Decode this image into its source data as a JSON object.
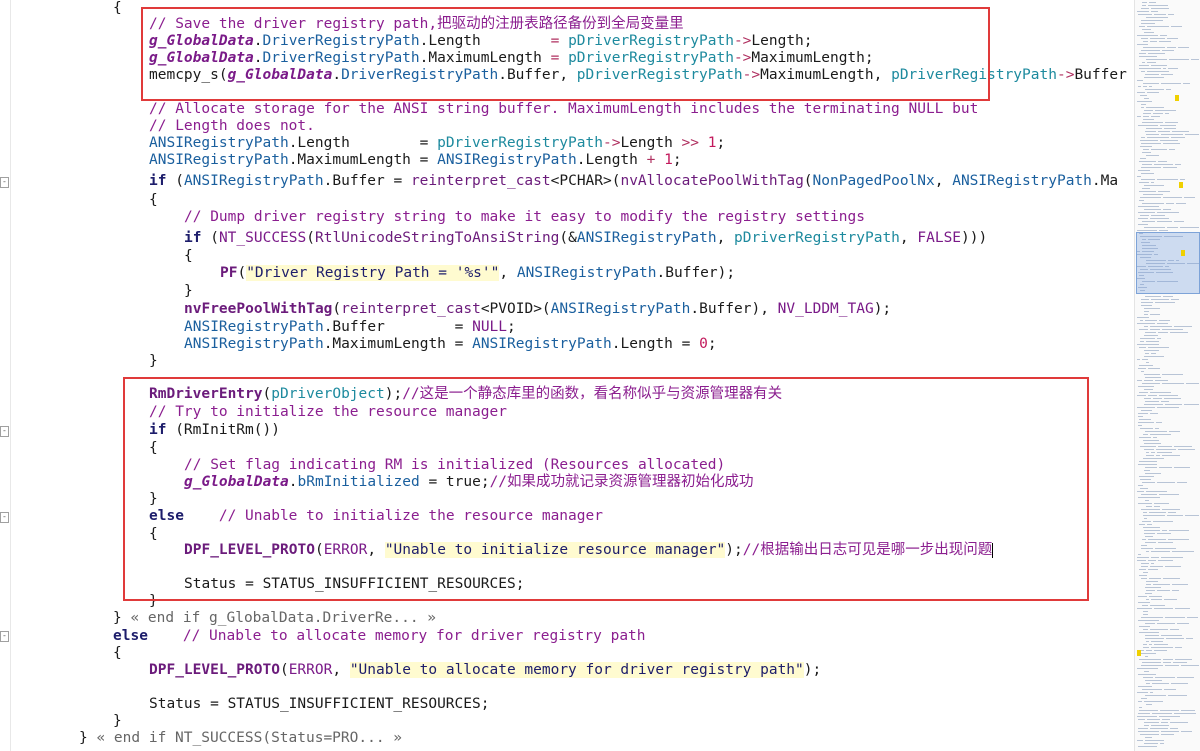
{
  "editor": {
    "lines": [
      [
        [
          "",
          "{"
        ]
      ],
      [
        [
          "cm",
          "// Save the driver registry path,把驱动的注册表路径备份到全局变量里"
        ]
      ],
      [
        [
          "gv",
          "g_GlobalData"
        ],
        [
          "",
          "."
        ],
        [
          "id",
          "DriverRegistryPath"
        ],
        [
          "",
          "."
        ],
        [
          "",
          "Length        "
        ],
        [
          "op",
          "= "
        ],
        [
          "par",
          "pDriverRegistryPath"
        ],
        [
          "op",
          "->"
        ],
        [
          "",
          "Length;"
        ]
      ],
      [
        [
          "gv",
          "g_GlobalData"
        ],
        [
          "",
          "."
        ],
        [
          "id",
          "DriverRegistryPath"
        ],
        [
          "",
          "."
        ],
        [
          "",
          "MaximumLength "
        ],
        [
          "op",
          "= "
        ],
        [
          "par",
          "pDriverRegistryPath"
        ],
        [
          "op",
          "->"
        ],
        [
          "",
          "MaximumLength;"
        ]
      ],
      [
        [
          "",
          "memcpy_s("
        ],
        [
          "gv",
          "g_GlobalData"
        ],
        [
          "",
          "."
        ],
        [
          "id",
          "DriverRegistryPath"
        ],
        [
          "",
          ".Buffer, "
        ],
        [
          "par",
          "pDriverRegistryPath"
        ],
        [
          "op",
          "->"
        ],
        [
          "",
          "MaximumLength, "
        ],
        [
          "par",
          "pDriverRegistryPath"
        ],
        [
          "op",
          "->"
        ],
        [
          "",
          "Buffer"
        ]
      ],
      [
        [
          "cm",
          "// Allocate storage for the ANSI string buffer. MaximumLength includes the terminating NULL but"
        ]
      ],
      [
        [
          "cm",
          "// Length does not."
        ]
      ],
      [
        [
          "id",
          "ANSIRegistryPath"
        ],
        [
          "",
          ".Length        = "
        ],
        [
          "par",
          "pDriverRegistryPath"
        ],
        [
          "op",
          "->"
        ],
        [
          "",
          "Length "
        ],
        [
          "op",
          ">> "
        ],
        [
          "num",
          "1"
        ],
        [
          "",
          ";"
        ]
      ],
      [
        [
          "id",
          "ANSIRegistryPath"
        ],
        [
          "",
          ".MaximumLength = "
        ],
        [
          "id",
          "ANSIRegistryPath"
        ],
        [
          "",
          ".Length "
        ],
        [
          "op",
          "+ "
        ],
        [
          "num",
          "1"
        ],
        [
          "",
          ";"
        ]
      ],
      [
        [
          "kw",
          "if "
        ],
        [
          "",
          "("
        ],
        [
          "id",
          "ANSIRegistryPath"
        ],
        [
          "",
          ".Buffer = "
        ],
        [
          "fn",
          "reinterpret_cast"
        ],
        [
          "",
          "<PCHAR>("
        ],
        [
          "fn",
          "nvAllocatePoolWithTag"
        ],
        [
          "",
          "("
        ],
        [
          "id",
          "NonPagedPoolNx"
        ],
        [
          "",
          ", "
        ],
        [
          "id",
          "ANSIRegistryPath"
        ],
        [
          "",
          ".Ma"
        ]
      ],
      [
        [
          "",
          "{"
        ]
      ],
      [
        [
          "cm",
          "// Dump driver registry string to make it easy to modify the registry settings"
        ]
      ],
      [
        [
          "kw",
          "if "
        ],
        [
          "",
          "("
        ],
        [
          "mac",
          "NT_SUCCESS"
        ],
        [
          "",
          "("
        ],
        [
          "fn",
          "RtlUnicodeStringToAnsiString"
        ],
        [
          "",
          "(&"
        ],
        [
          "id",
          "ANSIRegistryPath"
        ],
        [
          "",
          ", "
        ],
        [
          "par",
          "pDriverRegistryPath"
        ],
        [
          "",
          ", "
        ],
        [
          "mac",
          "FALSE"
        ],
        [
          "",
          ")))"
        ]
      ],
      [
        [
          "",
          "{"
        ]
      ],
      [
        [
          "fnb",
          "PF"
        ],
        [
          "",
          "("
        ],
        [
          "str",
          "\"Driver Registry Path = '%s'\""
        ],
        [
          "",
          ", "
        ],
        [
          "id",
          "ANSIRegistryPath"
        ],
        [
          "",
          ".Buffer);"
        ]
      ],
      [
        [
          "",
          "}"
        ]
      ],
      [
        [
          "fnb",
          "nvFreePoolWithTag"
        ],
        [
          "",
          "("
        ],
        [
          "fn",
          "reinterpret_cast"
        ],
        [
          "",
          "<PVOID>("
        ],
        [
          "id",
          "ANSIRegistryPath"
        ],
        [
          "",
          ".Buffer), "
        ],
        [
          "mac",
          "NV_LDDM_TAG"
        ],
        [
          "",
          ");"
        ]
      ],
      [
        [
          "id",
          "ANSIRegistryPath"
        ],
        [
          "",
          ".Buffer        = "
        ],
        [
          "mac",
          "NULL"
        ],
        [
          "",
          ";"
        ]
      ],
      [
        [
          "id",
          "ANSIRegistryPath"
        ],
        [
          "",
          ".MaximumLength = "
        ],
        [
          "id",
          "ANSIRegistryPath"
        ],
        [
          "",
          ".Length = "
        ],
        [
          "num",
          "0"
        ],
        [
          "",
          ";"
        ]
      ],
      [
        [
          "",
          "}"
        ]
      ],
      [
        [
          "fnb",
          "RmDriverEntry"
        ],
        [
          "",
          "("
        ],
        [
          "par",
          "pDriverObject"
        ],
        [
          "",
          ");"
        ],
        [
          "cm",
          "//这是一个静态库里的函数，看名称似乎与资源管理器有关"
        ]
      ],
      [
        [
          "cm",
          "// Try to initialize the resource manager"
        ]
      ],
      [
        [
          "kw",
          "if "
        ],
        [
          "",
          "(RmInitRm())"
        ]
      ],
      [
        [
          "",
          "{"
        ]
      ],
      [
        [
          "cm",
          "// Set flag indicating RM is initialized (Resources allocated)"
        ]
      ],
      [
        [
          "gv",
          "g_GlobalData"
        ],
        [
          "",
          "."
        ],
        [
          "id",
          "bRmInitialized"
        ],
        [
          "",
          " = true;"
        ],
        [
          "cm",
          "//如果成功就记录资源管理器初始化成功"
        ]
      ],
      [
        [
          "",
          "}"
        ]
      ],
      [
        [
          "kw",
          "else    "
        ],
        [
          "cm",
          "// Unable to initialize the resource manager"
        ]
      ],
      [
        [
          "",
          "{"
        ]
      ],
      [
        [
          "fnb",
          "DPF_LEVEL_PROTO"
        ],
        [
          "",
          "("
        ],
        [
          "mac",
          "ERROR"
        ],
        [
          "",
          ", "
        ],
        [
          "str",
          "\"Unable to initialize resource manager\""
        ],
        [
          "",
          ");"
        ],
        [
          "cm",
          "//根据输出日志可见是哪一步出现问题"
        ]
      ],
      [
        [
          "",
          "Status = STATUS_INSUFFICIENT_RESOURCES;"
        ]
      ],
      [
        [
          "",
          "}"
        ]
      ],
      [
        [
          "",
          "} "
        ],
        [
          "fold-txt",
          "« end if g_GlobalData.DriverRe... »"
        ]
      ],
      [
        [
          "kw",
          "else    "
        ],
        [
          "cm",
          "// Unable to allocate memory for driver registry path"
        ]
      ],
      [
        [
          "",
          "{"
        ]
      ],
      [
        [
          "fnb",
          "DPF_LEVEL_PROTO"
        ],
        [
          "",
          "("
        ],
        [
          "mac",
          "ERROR"
        ],
        [
          "",
          ", "
        ],
        [
          "str",
          "\"Unable to allocate memory for driver registry path\""
        ],
        [
          "",
          ");"
        ]
      ],
      [
        [
          "",
          "Status = STATUS_INSUFFICIENT_RESOURCES;"
        ]
      ],
      [
        [
          "",
          "}"
        ]
      ],
      [
        [
          "",
          "} "
        ],
        [
          "fold-txt",
          "« end if NT_SUCCESS(Status=PRO... »"
        ]
      ]
    ]
  },
  "colors": {
    "highlight_border": "#e03a3a",
    "string_background": "#fffbd0"
  }
}
